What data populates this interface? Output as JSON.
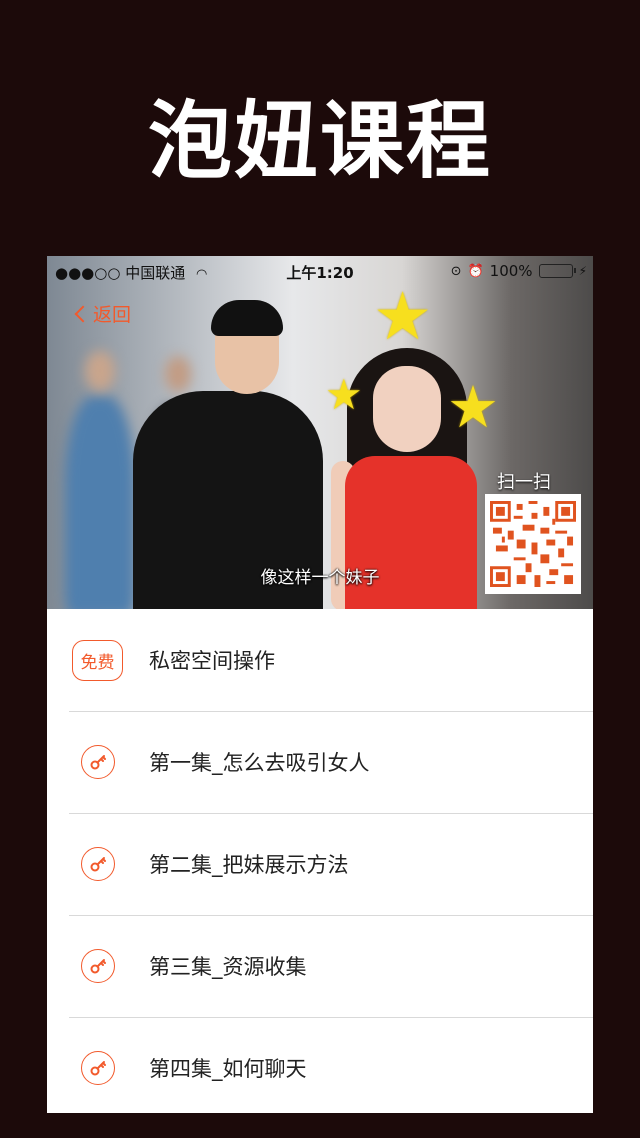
{
  "promo": {
    "title": "泡妞课程"
  },
  "status_bar": {
    "carrier": "●●●○○ 中国联通",
    "time": "上午1:20",
    "battery": "100%"
  },
  "nav": {
    "back_label": "返回"
  },
  "video": {
    "subtitle": "像这样一个妹子",
    "scan_label": "扫一扫"
  },
  "list": {
    "items": [
      {
        "badge": "免费",
        "label": "私密空间操作",
        "icon": "free-badge"
      },
      {
        "label": "第一集_怎么去吸引女人",
        "icon": "key-icon"
      },
      {
        "label": "第二集_把妹展示方法",
        "icon": "key-icon"
      },
      {
        "label": "第三集_资源收集",
        "icon": "key-icon"
      },
      {
        "label": "第四集_如何聊天",
        "icon": "key-icon"
      }
    ]
  },
  "colors": {
    "accent": "#f25a2c",
    "background": "#1c0a0a",
    "battery": "#35c93a"
  }
}
